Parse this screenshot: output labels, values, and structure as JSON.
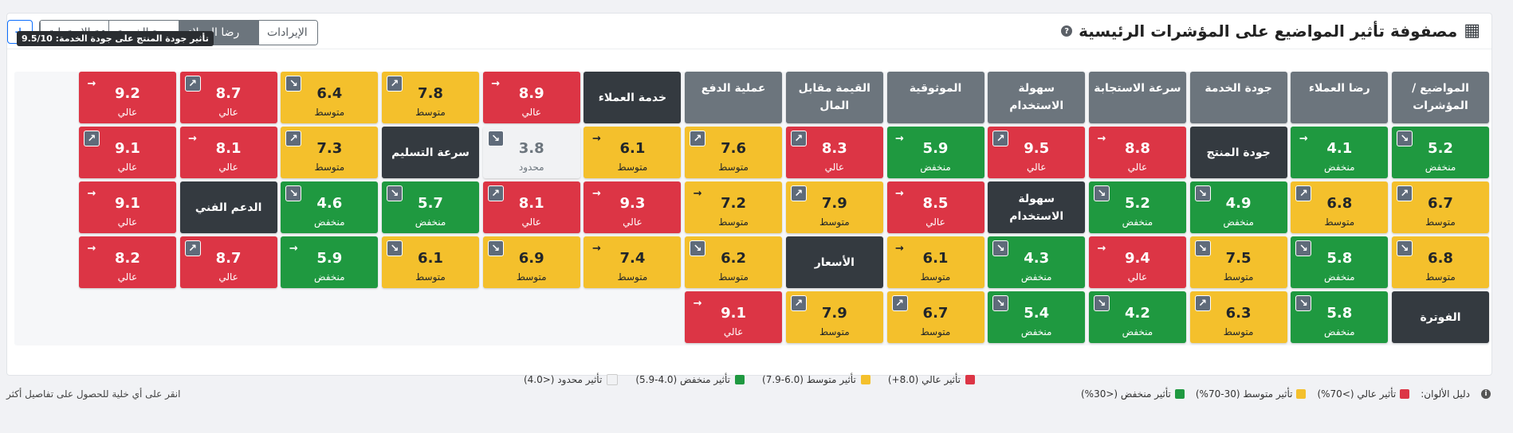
{
  "title": "مصفوفة تأثير المواضيع على المؤشرات الرئيسية",
  "tabs": [
    {
      "label": "الإيرادات",
      "active": false
    },
    {
      "label": "رضا العملاء",
      "active": true
    },
    {
      "label": "جودة الخدمة",
      "active": false
    },
    {
      "label": "سرعة الاستجابة",
      "active": false
    }
  ],
  "tooltip": "تأثير جودة المنتج على جودة الخدمة: 9.5/10",
  "columns": [
    "المواضيع / المؤشرات",
    "رضا العملاء",
    "جودة الخدمة",
    "سرعة الاستجابة",
    "سهولة الاستخدام",
    "الموثوقية",
    "القيمة مقابل المال",
    "عملية الدفع",
    "خدمة العملاء",
    "",
    "",
    "",
    "",
    "",
    "",
    ""
  ],
  "rows": [
    {
      "label": "جودة المنتج",
      "cells": [
        {
          "v": "5.2",
          "t": "l",
          "a": "se"
        },
        {
          "v": "4.1",
          "t": "l",
          "a": "r"
        },
        {
          "v": "جودة المنتج",
          "t": "rh"
        },
        {
          "v": "8.8",
          "t": "h",
          "a": "r"
        },
        {
          "v": "9.5",
          "t": "h",
          "a": "ne"
        },
        {
          "v": "5.9",
          "t": "l",
          "a": "r"
        },
        {
          "v": "8.3",
          "t": "h",
          "a": "ne"
        },
        {
          "v": "7.6",
          "t": "m",
          "a": "ne"
        },
        {
          "v": "6.1",
          "t": "m",
          "a": "r"
        },
        {
          "v": "3.8",
          "t": "n",
          "a": "se"
        },
        {
          "v": "سرعة التسليم",
          "t": "rh"
        },
        {
          "v": "7.3",
          "t": "m",
          "a": "ne"
        },
        {
          "v": "8.1",
          "t": "h",
          "a": "r"
        },
        {
          "v": "9.1",
          "t": "h",
          "a": "ne"
        }
      ]
    },
    {
      "label": "سهولة الاستخدام",
      "cells": [
        {
          "v": "6.7",
          "t": "m",
          "a": "ne"
        },
        {
          "v": "6.8",
          "t": "m",
          "a": "ne"
        },
        {
          "v": "4.9",
          "t": "l",
          "a": "se"
        },
        {
          "v": "5.2",
          "t": "l",
          "a": "se"
        },
        {
          "v": "سهولة الاستخدام",
          "t": "rh"
        },
        {
          "v": "8.5",
          "t": "h",
          "a": "r"
        },
        {
          "v": "7.9",
          "t": "m",
          "a": "ne"
        },
        {
          "v": "7.2",
          "t": "m",
          "a": "r"
        },
        {
          "v": "9.3",
          "t": "h",
          "a": "r"
        },
        {
          "v": "8.1",
          "t": "h",
          "a": "ne"
        },
        {
          "v": "5.7",
          "t": "l",
          "a": "se"
        },
        {
          "v": "4.6",
          "t": "l",
          "a": "se"
        },
        {
          "v": "الدعم الفني",
          "t": "rh"
        },
        {
          "v": "9.1",
          "t": "h",
          "a": "r"
        }
      ]
    },
    {
      "label": "الأسعار",
      "cells": [
        {
          "v": "6.8",
          "t": "m",
          "a": "se"
        },
        {
          "v": "5.8",
          "t": "l",
          "a": "se"
        },
        {
          "v": "7.5",
          "t": "m",
          "a": "se"
        },
        {
          "v": "9.4",
          "t": "h",
          "a": "r"
        },
        {
          "v": "4.3",
          "t": "l",
          "a": "se"
        },
        {
          "v": "6.1",
          "t": "m",
          "a": "r"
        },
        {
          "v": "الأسعار",
          "t": "rh"
        },
        {
          "v": "6.2",
          "t": "m",
          "a": "se"
        },
        {
          "v": "7.4",
          "t": "m",
          "a": "r"
        },
        {
          "v": "6.9",
          "t": "m",
          "a": "se"
        },
        {
          "v": "6.1",
          "t": "m",
          "a": "se"
        },
        {
          "v": "5.9",
          "t": "l",
          "a": "r"
        },
        {
          "v": "8.7",
          "t": "h",
          "a": "ne"
        },
        {
          "v": "8.2",
          "t": "h",
          "a": "r"
        }
      ]
    },
    {
      "label": "الفوترة",
      "cells": [
        {
          "v": "الفوترة",
          "t": "rh"
        },
        {
          "v": "5.8",
          "t": "l",
          "a": "se"
        },
        {
          "v": "6.3",
          "t": "m",
          "a": "ne"
        },
        {
          "v": "4.2",
          "t": "l",
          "a": "se"
        },
        {
          "v": "5.4",
          "t": "l",
          "a": "se"
        },
        {
          "v": "6.7",
          "t": "m",
          "a": "ne"
        },
        {
          "v": "7.9",
          "t": "m",
          "a": "ne"
        },
        {
          "v": "9.1",
          "t": "h",
          "a": "r"
        }
      ]
    }
  ],
  "header_row": [
    {
      "v": "8.9",
      "t": "h",
      "a": "r"
    },
    {
      "v": "7.8",
      "t": "m",
      "a": "ne"
    },
    {
      "v": "6.4",
      "t": "m",
      "a": "se"
    },
    {
      "v": "8.7",
      "t": "h",
      "a": "ne"
    },
    {
      "v": "9.2",
      "t": "h",
      "a": "r"
    }
  ],
  "level_labels": {
    "h": "عالي",
    "m": "متوسط",
    "l": "منخفض",
    "n": "محدود"
  },
  "legend": [
    {
      "label": "تأثير عالي (8.0+)",
      "color": "#dc3545"
    },
    {
      "label": "تأثير متوسط (6.0-7.9)",
      "color": "#f4c02c"
    },
    {
      "label": "تأثير منخفض (4.0-5.9)",
      "color": "#1f9940"
    },
    {
      "label": "تأثير محدود (<4.0)",
      "color": "#f1f2f4"
    }
  ],
  "footer": {
    "guide_label": "دليل الألوان:",
    "guide": [
      {
        "label": "تأثير عالي (>70%)",
        "color": "#dc3545"
      },
      {
        "label": "تأثير متوسط (30-70%)",
        "color": "#f4c02c"
      },
      {
        "label": "تأثير منخفض (<30%)",
        "color": "#1f9940"
      }
    ],
    "hint": "انقر على أي خلية للحصول على تفاصيل أكثر"
  },
  "icons": {
    "table": "table-grid-icon",
    "help": "help-circle-icon",
    "add": "plus-icon",
    "info": "info-icon"
  }
}
